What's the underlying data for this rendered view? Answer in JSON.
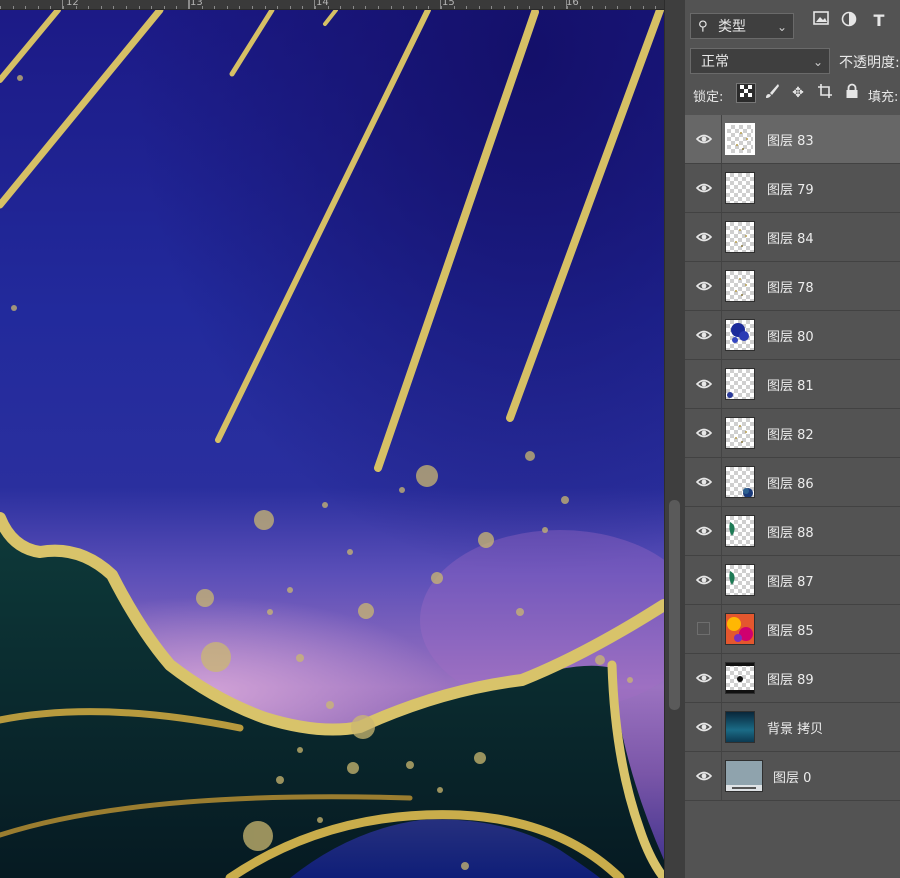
{
  "ruler": {
    "marks": [
      "12",
      "13",
      "14",
      "15",
      "16"
    ]
  },
  "toolbar": {
    "filter_label": "类型",
    "blend_mode": "正常",
    "opacity_label": "不透明度:",
    "lock_label": "锁定:",
    "fill_label": "填充:"
  },
  "colors": {
    "panel_bg": "#535353",
    "selected_row": "#676767",
    "gold_stroke": "#d8c36a",
    "sky_deep": "#1a1880",
    "sky_purple": "#8f62b8",
    "sea_green": "#0d2f33"
  },
  "layers": [
    {
      "name": "图层 83",
      "visible": true,
      "selected": true,
      "thumb": "sparkle"
    },
    {
      "name": "图层 79",
      "visible": true,
      "selected": false,
      "thumb": "blank"
    },
    {
      "name": "图层 84",
      "visible": true,
      "selected": false,
      "thumb": "sparkle"
    },
    {
      "name": "图层 78",
      "visible": true,
      "selected": false,
      "thumb": "sparkle"
    },
    {
      "name": "图层 80",
      "visible": true,
      "selected": false,
      "thumb": "blue-splash"
    },
    {
      "name": "图层 81",
      "visible": true,
      "selected": false,
      "thumb": "blue-dot"
    },
    {
      "name": "图层 82",
      "visible": true,
      "selected": false,
      "thumb": "sparkle"
    },
    {
      "name": "图层 86",
      "visible": true,
      "selected": false,
      "thumb": "blue-gem"
    },
    {
      "name": "图层 88",
      "visible": true,
      "selected": false,
      "thumb": "green-leaf"
    },
    {
      "name": "图层 87",
      "visible": true,
      "selected": false,
      "thumb": "green-leaf"
    },
    {
      "name": "图层 85",
      "visible": false,
      "selected": false,
      "thumb": "colorful"
    },
    {
      "name": "图层 89",
      "visible": true,
      "selected": false,
      "thumb": "black-frame"
    },
    {
      "name": "背景 拷贝",
      "visible": true,
      "selected": false,
      "thumb": "gradient-teal"
    },
    {
      "name": "图层 0",
      "visible": true,
      "selected": false,
      "thumb": "gray-doc"
    }
  ]
}
